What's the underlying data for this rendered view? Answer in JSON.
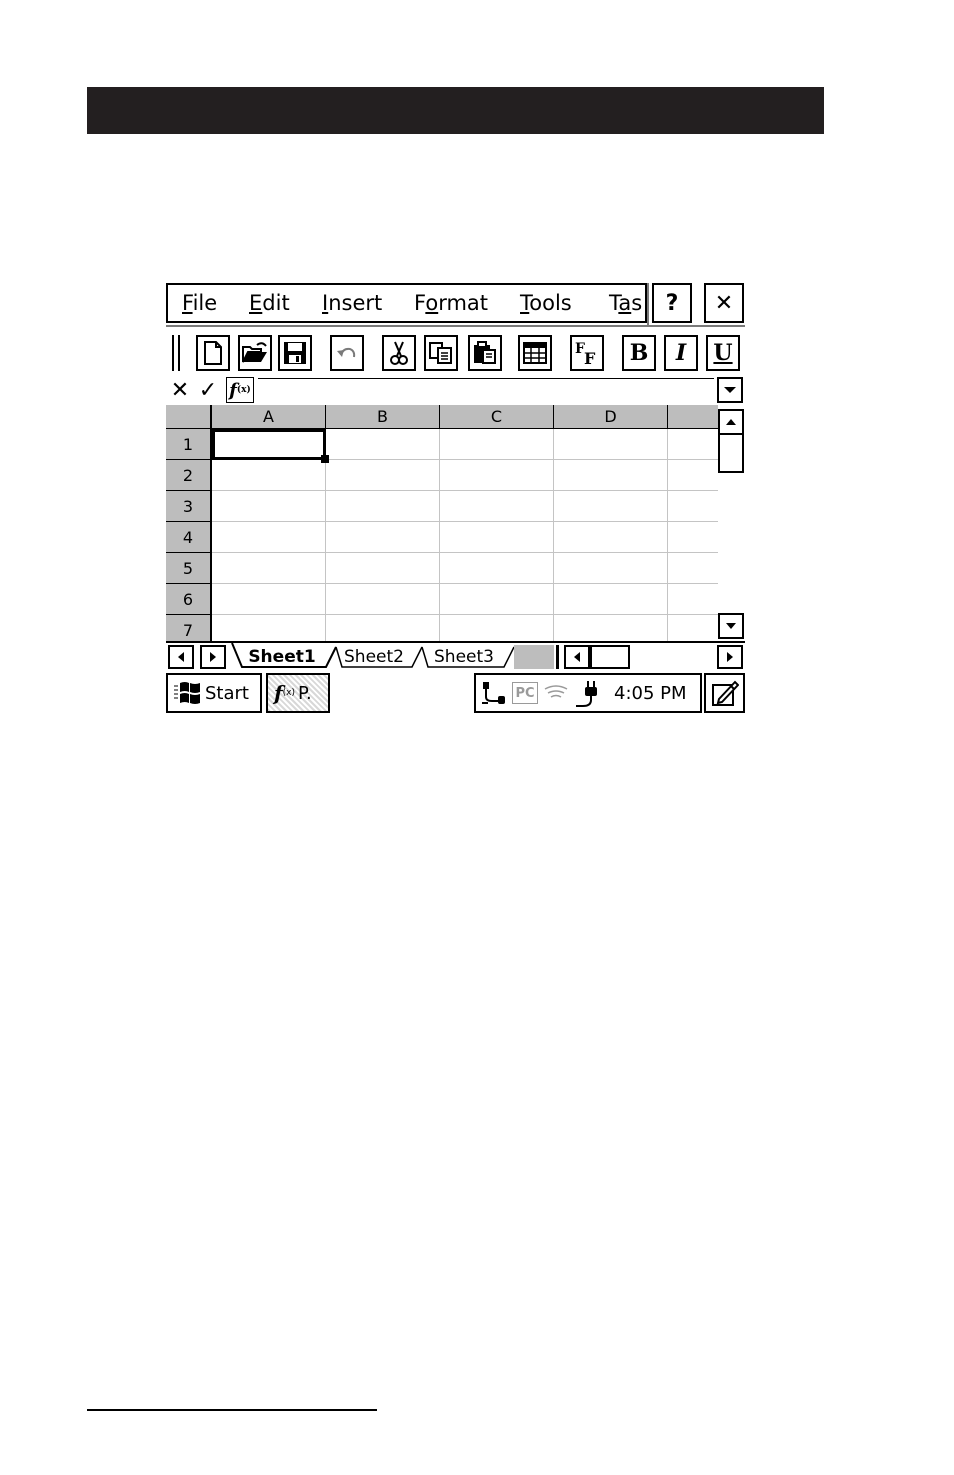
{
  "menubar": {
    "items": [
      {
        "label": "File",
        "mnemonic": "F",
        "rest": "ile"
      },
      {
        "label": "Edit",
        "mnemonic": "E",
        "rest": "dit"
      },
      {
        "label": "Insert",
        "mnemonic": "I",
        "rest": "nsert"
      },
      {
        "label": "Format",
        "pre": "F",
        "mnemonic": "o",
        "rest": "rmat"
      },
      {
        "label": "Tools",
        "mnemonic": "T",
        "rest": "ools"
      },
      {
        "label": "Tas",
        "pre": "T",
        "mnemonic": "a",
        "rest": "s"
      }
    ],
    "help_label": "?",
    "close_label": "✕"
  },
  "toolbar": {
    "font_label": "F",
    "bold_label": "B",
    "italic_label": "I",
    "underline_label": "U"
  },
  "formulabar": {
    "cancel_label": "✕",
    "accept_label": "✓",
    "function_label": "f",
    "value": ""
  },
  "grid": {
    "columns": [
      "A",
      "B",
      "C",
      "D",
      ""
    ],
    "rows": [
      "1",
      "2",
      "3",
      "4",
      "5",
      "6",
      "7"
    ],
    "active_cell": "A1"
  },
  "sheets": {
    "tabs": [
      "Sheet1",
      "Sheet2",
      "Sheet3"
    ],
    "active": "Sheet1"
  },
  "taskbar": {
    "start_label": "Start",
    "task_label": "P.",
    "tray_pc_label": "PC",
    "clock": "4:05 PM"
  }
}
